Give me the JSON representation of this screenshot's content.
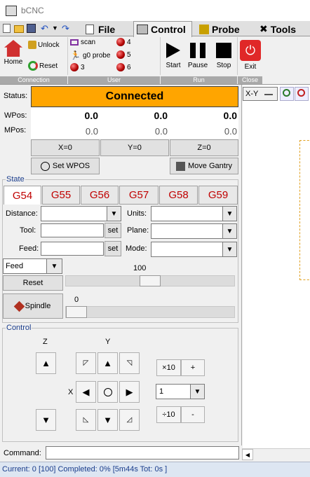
{
  "window": {
    "title": "bCNC"
  },
  "tabs": [
    {
      "label": "File"
    },
    {
      "label": "Control"
    },
    {
      "label": "Probe"
    },
    {
      "label": "Tools"
    }
  ],
  "ribbon": {
    "home": "Home",
    "unlock": "Unlock",
    "reset": "Reset",
    "connection_section": "Connection",
    "user_section": "User",
    "run_section": "Run",
    "close_section": "Close",
    "scan": "scan",
    "g0probe": "g0 probe",
    "btn3": "3",
    "btn4": "4",
    "btn5": "5",
    "btn6": "6",
    "start": "Start",
    "pause": "Pause",
    "stop": "Stop",
    "exit": "Exit"
  },
  "status": {
    "label": "Status:",
    "value": "Connected",
    "color": "#ffa500",
    "wpos_label": "WPos:",
    "mpos_label": "MPos:",
    "wpos": [
      "0.0",
      "0.0",
      "0.0"
    ],
    "mpos": [
      "0.0",
      "0.0",
      "0.0"
    ],
    "zero_x": "X=0",
    "zero_y": "Y=0",
    "zero_z": "Z=0",
    "set_wpos": "Set WPOS",
    "move_gantry": "Move Gantry"
  },
  "view": {
    "plane": "X-Y"
  },
  "state": {
    "title": "State",
    "wcs": [
      "G54",
      "G55",
      "G56",
      "G57",
      "G58",
      "G59"
    ],
    "distance_label": "Distance:",
    "units_label": "Units:",
    "tool_label": "Tool:",
    "plane_label": "Plane:",
    "feed_label": "Feed:",
    "mode_label": "Mode:",
    "set_label": "set",
    "override_mode": "Feed",
    "reset": "Reset",
    "override_value": "100",
    "override_level": 0.5,
    "spindle": "Spindle",
    "spindle_value": "0",
    "spindle_level": 0
  },
  "control": {
    "title": "Control",
    "z_label": "Z",
    "y_label": "Y",
    "x_label": "X",
    "x10": "×10",
    "plus": "+",
    "step": "1",
    "div10": "÷10",
    "minus": "-"
  },
  "command": {
    "label": "Command:"
  },
  "statusbar": {
    "text": "Current: 0 [100]  Completed: 0% [5m44s Tot: 0s ]"
  }
}
